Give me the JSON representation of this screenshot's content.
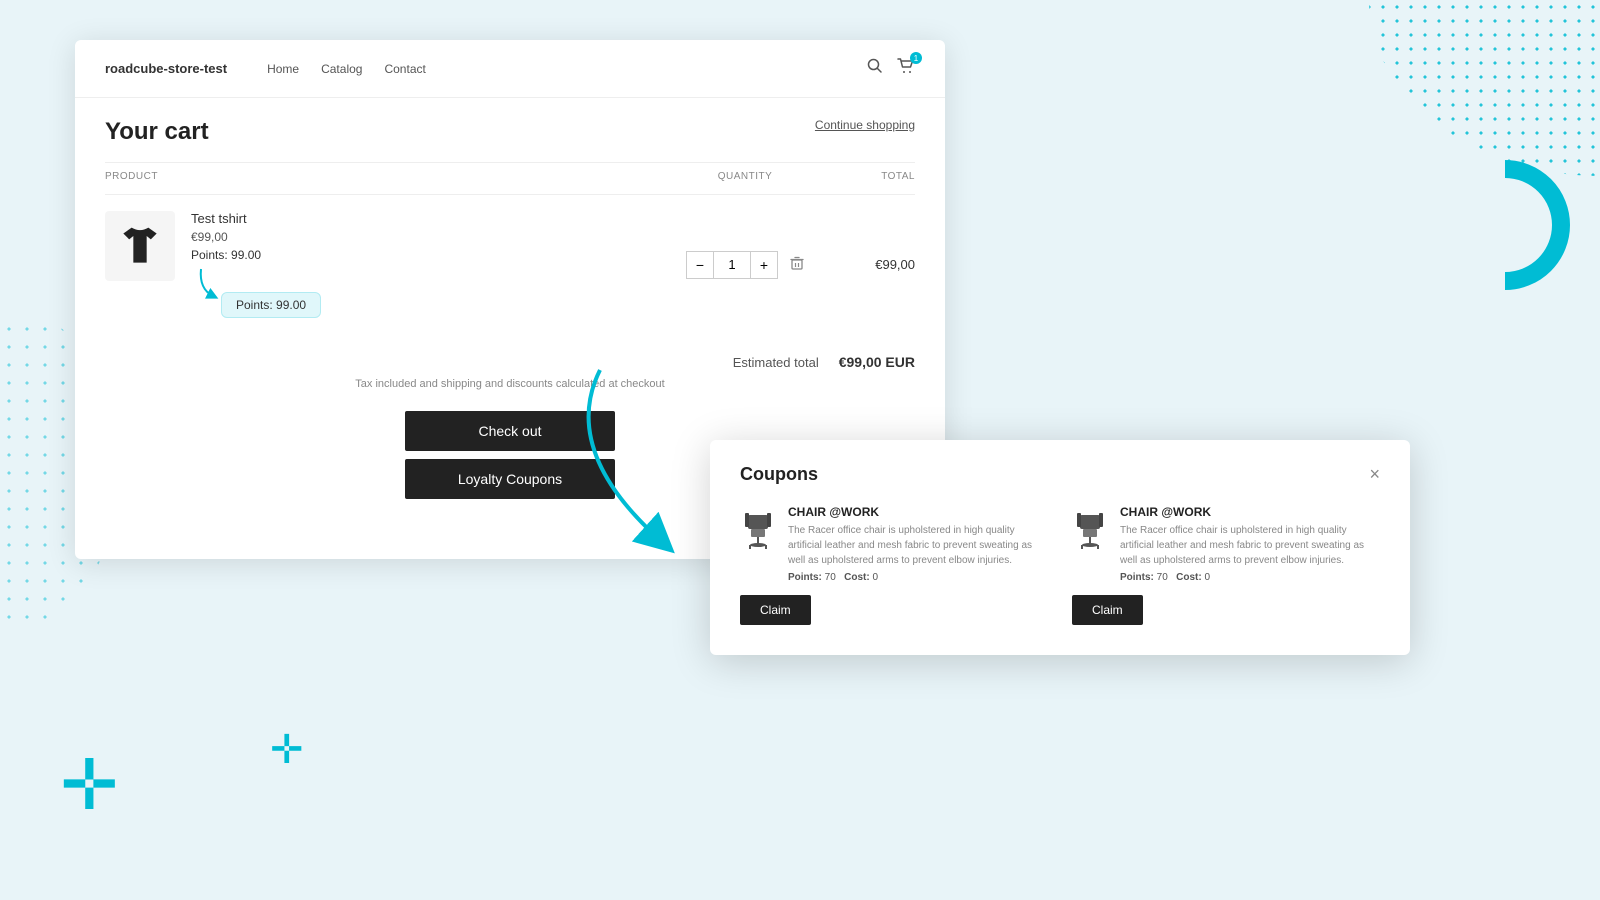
{
  "background": {
    "plus_large": "+",
    "plus_small": "+"
  },
  "nav": {
    "brand": "roadcube-store-test",
    "links": [
      "Home",
      "Catalog",
      "Contact"
    ],
    "cart_count": "1"
  },
  "cart": {
    "title": "Your cart",
    "continue_shopping": "Continue shopping",
    "columns": {
      "product": "PRODUCT",
      "quantity": "QUANTITY",
      "total": "TOTAL"
    },
    "item": {
      "name": "Test tshirt",
      "price": "€99,00",
      "points_label": "Points:",
      "points_value": "99.00",
      "quantity": "1",
      "total": "€99,00",
      "tooltip_text": "Points: 99.00"
    },
    "estimated_label": "Estimated total",
    "estimated_value": "€99,00 EUR",
    "tax_note": "Tax included and shipping and discounts calculated at checkout",
    "checkout_label": "Check out",
    "loyalty_label": "Loyalty Coupons"
  },
  "coupons_modal": {
    "title": "Coupons",
    "close": "×",
    "cards": [
      {
        "name": "CHAIR @WORK",
        "description": "The Racer office chair is upholstered in high quality artificial leather and mesh fabric to prevent sweating as well as upholstered arms to prevent elbow injuries.",
        "points": "70",
        "cost": "0",
        "claim_label": "Claim"
      },
      {
        "name": "CHAIR @WORK",
        "description": "The Racer office chair is upholstered in high quality artificial leather and mesh fabric to prevent sweating as well as upholstered arms to prevent elbow injuries.",
        "points": "70",
        "cost": "0",
        "claim_label": "Claim"
      }
    ]
  }
}
